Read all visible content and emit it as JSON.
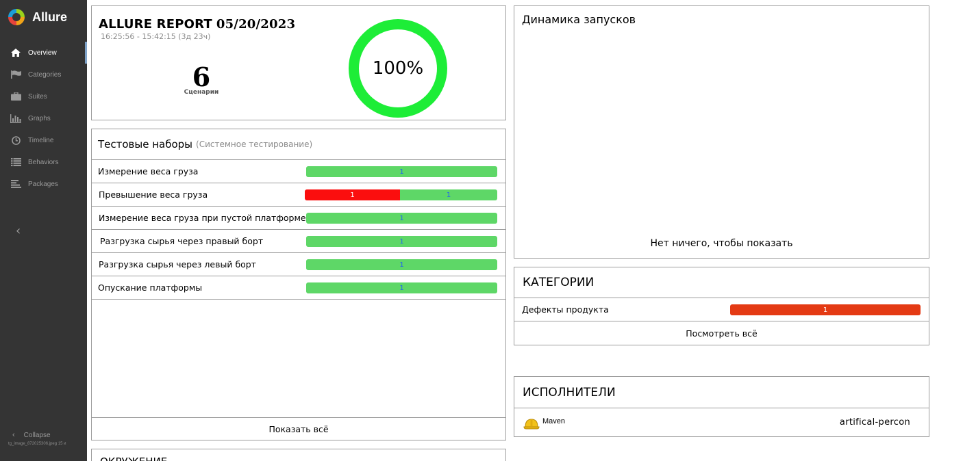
{
  "sidebar": {
    "brand": "Allure",
    "items": [
      {
        "label": "Overview",
        "icon": "home-icon",
        "active": true
      },
      {
        "label": "Categories",
        "icon": "flag-icon",
        "active": false
      },
      {
        "label": "Suites",
        "icon": "briefcase-icon",
        "active": false
      },
      {
        "label": "Graphs",
        "icon": "bar-chart-icon",
        "active": false
      },
      {
        "label": "Timeline",
        "icon": "clock-icon",
        "active": false
      },
      {
        "label": "Behaviors",
        "icon": "list-icon",
        "active": false
      },
      {
        "label": "Packages",
        "icon": "align-left-icon",
        "active": false
      }
    ],
    "collapse_label": "Collapse",
    "file_caption": "tg_image_872025306.jpeg 15 и"
  },
  "summary": {
    "title": "ALLURE REPORT",
    "date": "05/20/2023",
    "time_range": "16:25:56 - 15:42:15 (3д 23ч)",
    "count": "6",
    "count_label": "Сценарии",
    "percent": "100%",
    "percent_color": "#1ded37"
  },
  "suites": {
    "title": "Тестовые наборы",
    "subtitle": "(Системное тестирование)",
    "rows": [
      {
        "name": "Измерение веса груза",
        "failed": null,
        "passed": "1"
      },
      {
        "name": "Превышение веса груза",
        "failed": "1",
        "passed": "1"
      },
      {
        "name": "Измерение веса груза при пустой платформе",
        "failed": null,
        "passed": "1"
      },
      {
        "name": "Разгрузка сырья через правый борт",
        "failed": null,
        "passed": "1"
      },
      {
        "name": "Разгрузка сырья через левый борт",
        "failed": null,
        "passed": "1"
      },
      {
        "name": "Опускание платформы",
        "failed": null,
        "passed": "1"
      }
    ],
    "show_all": "Показать всё",
    "colors": {
      "passed": "#5ed767",
      "failed": "#fb0e0e"
    }
  },
  "environment": {
    "title": "ОКРУЖЕНИЕ"
  },
  "trend": {
    "title": "Динамика запусков",
    "empty": "Нет ничего, чтобы показать"
  },
  "categories": {
    "title": "КАТЕГОРИИ",
    "rows": [
      {
        "name": "Дефекты продукта",
        "count": "1",
        "color": "#e43a14"
      }
    ],
    "view_all": "Посмотреть всё"
  },
  "executors": {
    "title": "ИСПОЛНИТЕЛИ",
    "rows": [
      {
        "name": "Maven",
        "icon": "hard-hat-icon",
        "build": "artifical-percon"
      }
    ]
  }
}
